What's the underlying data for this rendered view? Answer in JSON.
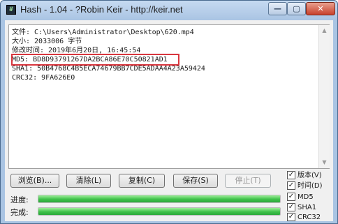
{
  "window": {
    "title": "Hash - 1.04 - ?Robin Keir - http://keir.net",
    "icon": "hash-app-icon",
    "controls": {
      "minimize": "—",
      "maximize": "▢",
      "close": "✕"
    }
  },
  "output": {
    "lines": [
      "文件: C:\\Users\\Administrator\\Desktop\\620.mp4",
      "大小: 2033006 字节",
      "修改时间: 2019年6月20日, 16:45:54",
      "MD5: BD8D93791267DA2BCA86E70C50821AD1",
      "SHA1: 50B4768C4B5ECA74679BB7CDE5ADAA4A23A59424",
      "CRC32: 9FA626E0"
    ],
    "highlighted_line": "MD5"
  },
  "buttons": {
    "browse": "浏览(B)...",
    "clear": "清除(L)",
    "copy": "复制(C)",
    "save": "保存(S)",
    "stop": "停止(T)"
  },
  "progress": {
    "progress_label": "进度:",
    "progress_value": 1.0,
    "complete_label": "完成:",
    "complete_value": 1.0
  },
  "options": [
    {
      "label": "版本(V)",
      "checked": true
    },
    {
      "label": "时间(D)",
      "checked": true
    },
    {
      "label": "MD5",
      "checked": true
    },
    {
      "label": "SHA1",
      "checked": true
    },
    {
      "label": "CRC32",
      "checked": true
    }
  ],
  "colors": {
    "highlight_border": "#d9363e",
    "progress_fill": "#3fc14a"
  }
}
